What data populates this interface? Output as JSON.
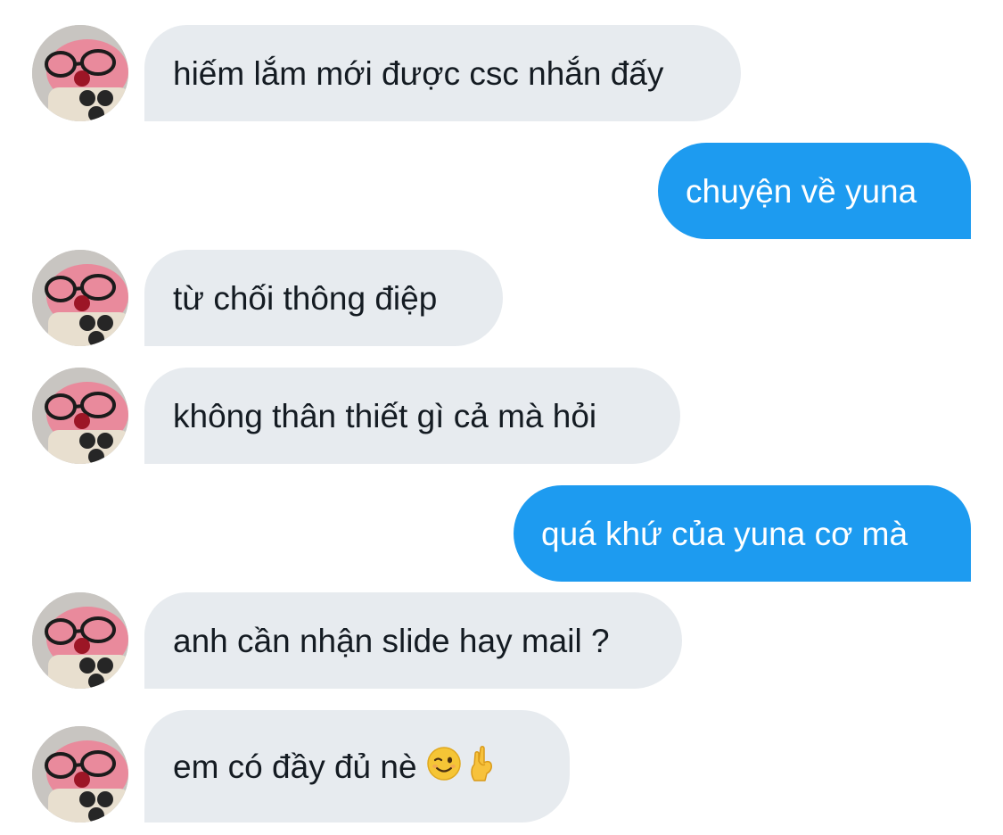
{
  "messages": [
    {
      "side": "in",
      "text": "hiếm lắm mới được csc nhắn đấy"
    },
    {
      "side": "out",
      "text": "chuyện về yuna"
    },
    {
      "side": "in",
      "text": "từ chối thông điệp"
    },
    {
      "side": "in",
      "text": "không thân thiết gì cả mà hỏi"
    },
    {
      "side": "out",
      "text": "quá khứ của yuna cơ mà"
    },
    {
      "side": "in",
      "text": "anh cần nhận slide hay mail ?"
    },
    {
      "side": "in",
      "text": "em có đầy đủ nè",
      "emojis": [
        "winking-face-emoji",
        "ok-hand-emoji"
      ]
    }
  ],
  "colors": {
    "incoming_bubble": "#e7ebef",
    "incoming_text": "#141b22",
    "outgoing_bubble": "#1d9bf0",
    "outgoing_text": "#ffffff"
  }
}
